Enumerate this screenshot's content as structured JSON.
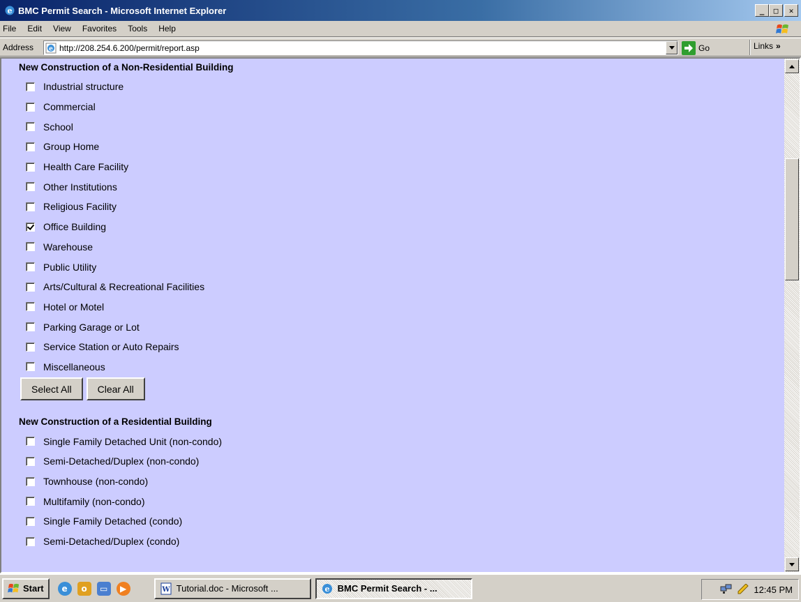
{
  "window": {
    "title": "BMC Permit Search - Microsoft Internet Explorer",
    "min_glyph": "_",
    "max_glyph": "□",
    "close_glyph": "✕"
  },
  "menu": [
    "File",
    "Edit",
    "View",
    "Favorites",
    "Tools",
    "Help"
  ],
  "address": {
    "label": "Address",
    "url": "http://208.254.6.200/permit/report.asp",
    "go_label": "Go",
    "links_label": "Links",
    "links_chevron": "»"
  },
  "sections": [
    {
      "heading": "New Construction of a Non-Residential Building",
      "options": [
        {
          "label": "Industrial structure",
          "checked": false
        },
        {
          "label": "Commercial",
          "checked": false
        },
        {
          "label": "School",
          "checked": false
        },
        {
          "label": "Group Home",
          "checked": false
        },
        {
          "label": "Health Care Facility",
          "checked": false
        },
        {
          "label": "Other Institutions",
          "checked": false
        },
        {
          "label": "Religious Facility",
          "checked": false
        },
        {
          "label": "Office Building",
          "checked": true
        },
        {
          "label": "Warehouse",
          "checked": false
        },
        {
          "label": "Public Utility",
          "checked": false
        },
        {
          "label": "Arts/Cultural & Recreational Facilities",
          "checked": false
        },
        {
          "label": "Hotel or Motel",
          "checked": false
        },
        {
          "label": "Parking Garage or Lot",
          "checked": false
        },
        {
          "label": "Service Station or Auto Repairs",
          "checked": false
        },
        {
          "label": "Miscellaneous",
          "checked": false
        }
      ],
      "buttons": {
        "select_all": "Select All",
        "clear_all": "Clear All"
      }
    },
    {
      "heading": "New Construction of a Residential Building",
      "options": [
        {
          "label": "Single Family Detached Unit (non-condo)",
          "checked": false
        },
        {
          "label": "Semi-Detached/Duplex (non-condo)",
          "checked": false
        },
        {
          "label": "Townhouse (non-condo)",
          "checked": false
        },
        {
          "label": "Multifamily (non-condo)",
          "checked": false
        },
        {
          "label": "Single Family Detached (condo)",
          "checked": false
        },
        {
          "label": "Semi-Detached/Duplex (condo)",
          "checked": false
        }
      ]
    }
  ],
  "taskbar": {
    "start_label": "Start",
    "tasks": [
      {
        "label": "Tutorial.doc - Microsoft ...",
        "active": false
      },
      {
        "label": "BMC Permit Search - ...",
        "active": true
      }
    ],
    "clock": "12:45 PM"
  },
  "colors": {
    "page_background": "#ccccff",
    "titlebar": "#0a246a",
    "chrome": "#d4d0c8"
  }
}
